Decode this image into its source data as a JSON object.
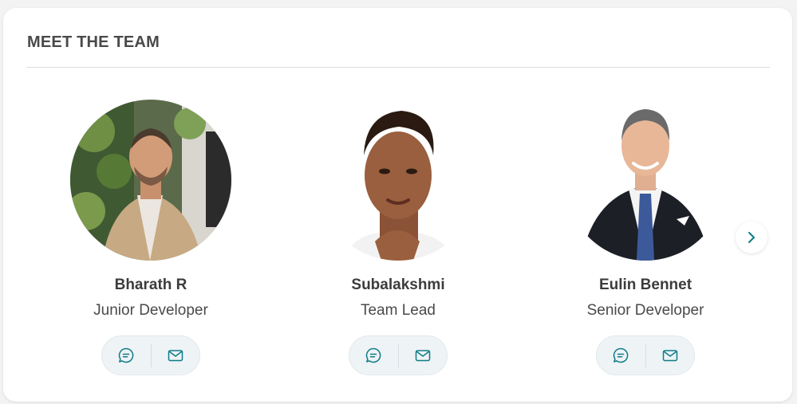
{
  "section": {
    "title": "MEET THE TEAM"
  },
  "members": [
    {
      "name": "Bharath R",
      "role": "Junior Developer"
    },
    {
      "name": "Subalakshmi",
      "role": "Team Lead"
    },
    {
      "name": "Eulin Bennet",
      "role": "Senior Developer"
    }
  ],
  "icons": {
    "chat": "chat-bubble-icon",
    "mail": "mail-icon",
    "next": "chevron-right-icon"
  },
  "colors": {
    "accent": "#0e7c86",
    "pill_bg": "#eef3f6",
    "title": "#4a4a4a"
  }
}
